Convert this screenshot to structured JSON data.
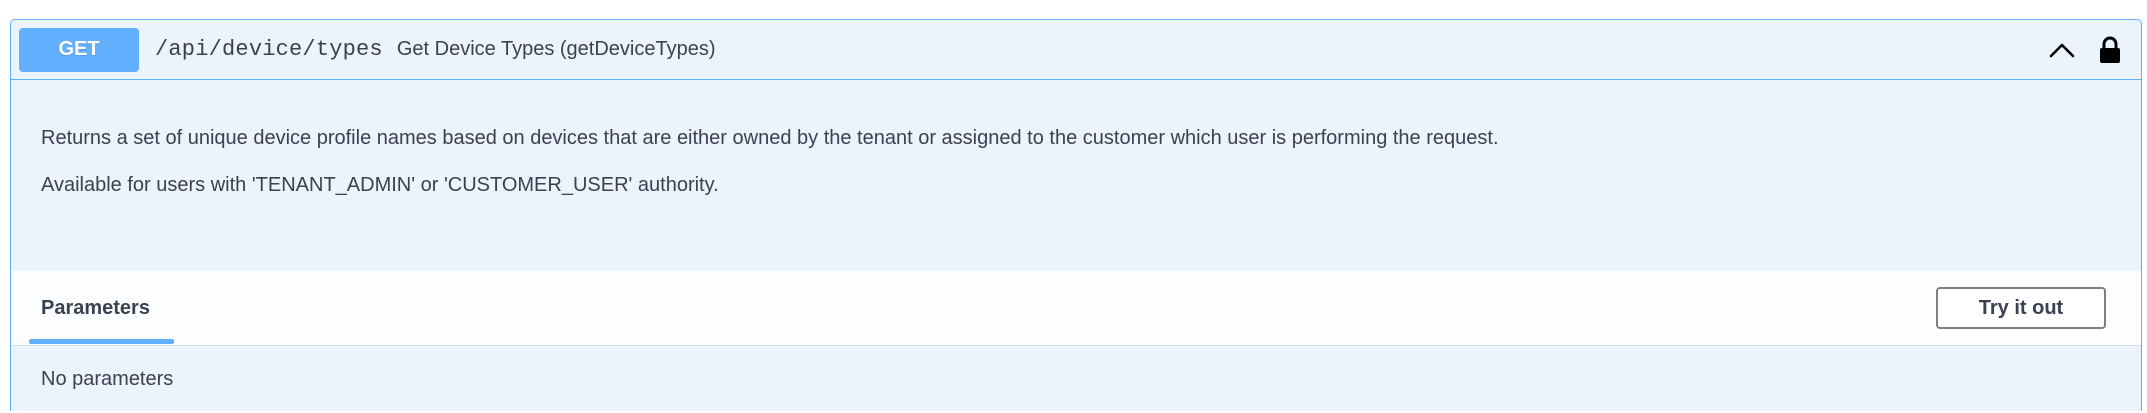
{
  "operation": {
    "method": "GET",
    "path": "/api/device/types",
    "summary": "Get Device Types (getDeviceTypes)",
    "expanded_icon": "chevron-up-icon",
    "auth_icon": "lock-icon"
  },
  "description": {
    "line1": "Returns a set of unique device profile names based on devices that are either owned by the tenant or assigned to the customer which user is performing the request.",
    "line2": "Available for users with 'TENANT_ADMIN' or 'CUSTOMER_USER' authority."
  },
  "parameters": {
    "tab_label": "Parameters",
    "try_button_label": "Try it out",
    "empty_text": "No parameters"
  },
  "colors": {
    "method_get": "#61affe",
    "block_background": "#ebf3fb",
    "text": "#3b4151"
  }
}
